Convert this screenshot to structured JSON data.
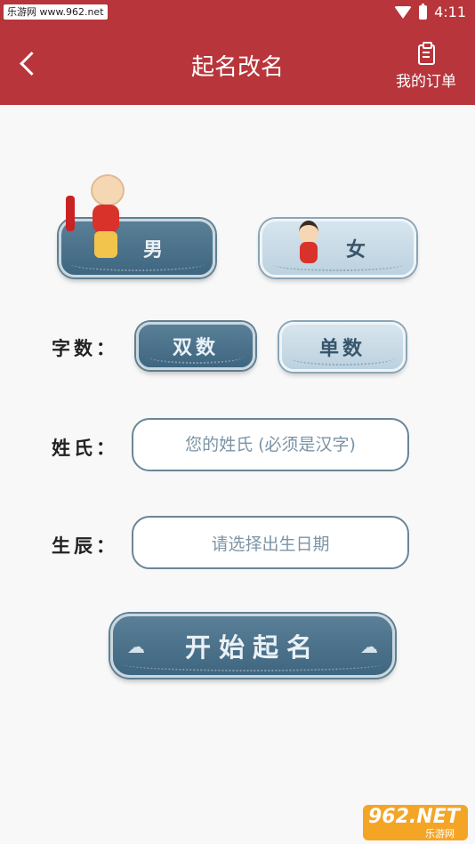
{
  "status_bar": {
    "watermark": "乐游网 www.962.net",
    "time": "4:11"
  },
  "app_bar": {
    "title": "起名改名",
    "orders_label": "我的订单"
  },
  "gender": {
    "male_label": "男",
    "female_label": "女"
  },
  "char_count": {
    "label": "字数：",
    "double_label": "双数",
    "single_label": "单数"
  },
  "surname": {
    "label": "姓氏：",
    "placeholder": "您的姓氏 (必须是汉字)"
  },
  "birth": {
    "label": "生辰：",
    "placeholder": "请选择出生日期"
  },
  "start_button": {
    "label": "开始起名"
  },
  "watermark_logo": {
    "main": "962.NET",
    "sub": "乐游网"
  },
  "colors": {
    "accent": "#b7353b",
    "plaque_dark": "#456c85",
    "plaque_light": "#c7dae6"
  }
}
